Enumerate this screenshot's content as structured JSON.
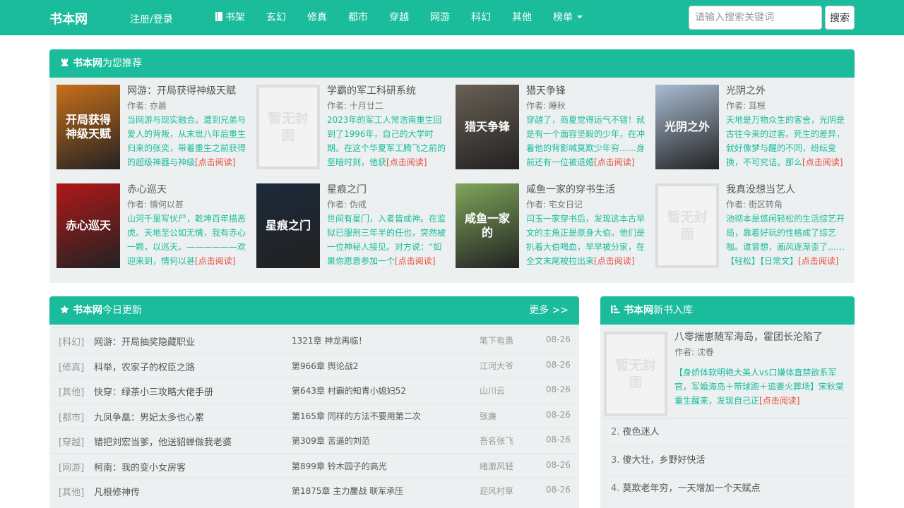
{
  "nav": {
    "brand": "书本网",
    "login": "注册/登录",
    "items": [
      "书架",
      "玄幻",
      "修真",
      "都市",
      "穿越",
      "网游",
      "科幻",
      "其他",
      "榜单"
    ],
    "search_placeholder": "请输入搜索关键词",
    "search_button": "搜索"
  },
  "recommend": {
    "brand": "书本网",
    "title": "为您推荐",
    "read_label": "[点击阅读]",
    "books": [
      {
        "title": "网游：开局获得神级天赋",
        "author": "作者: 亦晨",
        "desc": "当网游与现实融合。遭到兄弟与爱人的背叛，从末世八年后重生归来的张奕，带着重生之前获得的超级神器与神级",
        "cover": "开局获得神级天赋",
        "cover_color": "#c8701a"
      },
      {
        "title": "学霸的军工科研系统",
        "author": "作者: 十月廿二",
        "desc": "2023年的军工人常浩南重生回到了1996年，自己的大学时期。在这个华夏军工腾飞之前的至暗时刻，他获",
        "cover": "暂无封面",
        "cover_color": "#f3f3f3"
      },
      {
        "title": "猎天争锋",
        "author": "作者: 睡秋",
        "desc": "穿越了，商夏觉得运气不错！就是有一个面容坚毅的少年，在冲着他的背影喊莫欺少年穷……身前还有一位被退婚",
        "cover": "猎天争锋",
        "cover_color": "#6a6055"
      },
      {
        "title": "光阴之外",
        "author": "作者: 耳根",
        "desc": "天地是万物众生的客舍，光阴是古往今来的过客。死生的差异，就好像梦与醒的不同，纷纭变换，不可究诘。那么",
        "cover": "光阴之外",
        "cover_color": "#a9bcd3"
      },
      {
        "title": "赤心巡天",
        "author": "作者: 情何以甚",
        "desc": "山河千里写伏尸，乾坤百年描恶虎。天地至公如无情，我有赤心一颗，以巡天。——————欢迎来到，情何以甚",
        "cover": "赤心巡天",
        "cover_color": "#b01818"
      },
      {
        "title": "星痕之门",
        "author": "作者: 伪戒",
        "desc": "世间有星门，入者皆成神。在监狱已服刑三年半的任也，突然被一位神秘人接见。对方说：“如果你愿意参加一个",
        "cover": "星痕之门",
        "cover_color": "#1c2a3a"
      },
      {
        "title": "咸鱼一家的穿书生活",
        "author": "作者: 宅女日记",
        "desc": "闫玉一家穿书后，发现这本古早文的主角正是原身大伯。他们是扒着大伯喝血，早早被分家，在全文末尾被拉出来",
        "cover": "咸鱼一家的",
        "cover_color": "#7fa65a"
      },
      {
        "title": "我真没想当艺人",
        "author": "作者: 街区转角",
        "desc": "池彻本是悠闲轻松的生活综艺开局，靠着好玩的性格成了综艺咖。谁曾想，画风逐渐歪了……【轻松】【日常文】",
        "cover": "暂无封面",
        "cover_color": "#f3f3f3"
      }
    ]
  },
  "updates": {
    "brand": "书本网",
    "title": "今日更新",
    "more": "更多 >>",
    "rows": [
      {
        "cat": "[科幻]",
        "name": "网游：开局抽奖隐藏职业",
        "chapter": "1321章 神龙再临！",
        "author": "笔下有愚",
        "date": "08-26"
      },
      {
        "cat": "[修真]",
        "name": "科举，农家子的权臣之路",
        "chapter": "第966章 舆论战2",
        "author": "江河大爷",
        "date": "08-26"
      },
      {
        "cat": "[其他]",
        "name": "快穿：绿茶小三攻略大佬手册",
        "chapter": "第643章 村霸的知青小媳妇52",
        "author": "山川云",
        "date": "08-26"
      },
      {
        "cat": "[都市]",
        "name": "九凤争凰：男妃太多也心累",
        "chapter": "第165章 同样的方法不要用第二次",
        "author": "张廉",
        "date": "08-26"
      },
      {
        "cat": "[穿越]",
        "name": "错把刘宏当爹，他送貂蝉做我老婆",
        "chapter": "第309章 苦逼的刘范",
        "author": "吾名张飞",
        "date": "08-26"
      },
      {
        "cat": "[网游]",
        "name": "柯南：我的变小女房客",
        "chapter": "第899章 铃木园子的高光",
        "author": "绪澈风轻",
        "date": "08-26"
      },
      {
        "cat": "[其他]",
        "name": "凡根修神传",
        "chapter": "第1875章 主力鏖战 联军承压",
        "author": "迎风村草",
        "date": "08-26"
      }
    ]
  },
  "newbooks": {
    "brand": "书本网",
    "title": "新书入库",
    "first": {
      "title": "八零揣崽随军海岛，霍团长沦陷了",
      "author": "作者: 沈眷",
      "desc": "【身娇体软明艳大美人vs口嫌体直禁欲系军官，军婚海岛＋带球跑＋追妻火葬场】宋秋棠重生醒来，发现自己正",
      "cover": "暂无封面"
    },
    "items": [
      {
        "num": "2.",
        "title": "夜色迷人"
      },
      {
        "num": "3.",
        "title": "傻大壮，乡野好快活"
      },
      {
        "num": "4.",
        "title": "莫欺老年穷，一天增加一个天赋点"
      }
    ]
  },
  "colors": {
    "accent": "#1abc9c",
    "read_link": "#e74c3c",
    "panel_bg": "#ecf0f1"
  }
}
